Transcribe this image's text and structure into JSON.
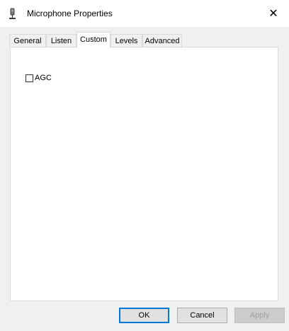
{
  "window": {
    "title": "Microphone Properties",
    "close_symbol": "✕",
    "icon": "microphone-icon"
  },
  "tabs": [
    {
      "label": "General",
      "active": false
    },
    {
      "label": "Listen",
      "active": false
    },
    {
      "label": "Custom",
      "active": true
    },
    {
      "label": "Levels",
      "active": false
    },
    {
      "label": "Advanced",
      "active": false
    }
  ],
  "custom": {
    "agc_label": "AGC",
    "agc_checked": false
  },
  "buttons": {
    "ok": "OK",
    "cancel": "Cancel",
    "apply": "Apply",
    "apply_enabled": false
  },
  "colors": {
    "focus_border": "#0078d7",
    "disabled_text": "#a0a0a0"
  }
}
